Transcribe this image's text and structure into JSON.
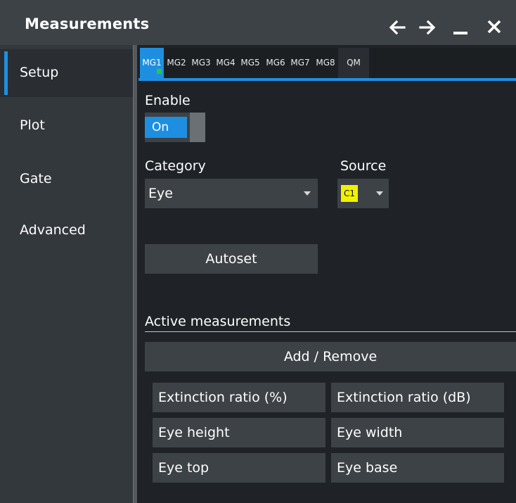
{
  "window": {
    "title": "Measurements"
  },
  "titlebar": {
    "buttons": [
      {
        "icon": "arrow-left-icon"
      },
      {
        "icon": "arrow-right-icon"
      },
      {
        "icon": "minimize-icon"
      },
      {
        "icon": "close-icon"
      }
    ]
  },
  "sidebar": {
    "items": [
      {
        "label": "Setup",
        "active": true
      },
      {
        "label": "Plot"
      },
      {
        "label": "Gate"
      },
      {
        "label": "Advanced"
      }
    ]
  },
  "tabs": [
    "MG1",
    "MG2",
    "MG3",
    "MG4",
    "MG5",
    "MG6",
    "MG7",
    "MG8",
    "QM"
  ],
  "active_tab": "MG1",
  "setup": {
    "enable_label": "Enable",
    "enable_value": "On",
    "category_label": "Category",
    "category_value": "Eye",
    "source_label": "Source",
    "source_value": "C1",
    "autoset_label": "Autoset",
    "active_measurements_label": "Active measurements",
    "add_remove_label": "Add / Remove",
    "measurements": [
      "Extinction ratio (%)",
      "Extinction ratio (dB)",
      "Eye height",
      "Eye width",
      "Eye top",
      "Eye base"
    ]
  },
  "colors": {
    "accent": "#1e8fe0",
    "source_c1": "#f2f200",
    "tab_indicator": "#27c93f"
  }
}
